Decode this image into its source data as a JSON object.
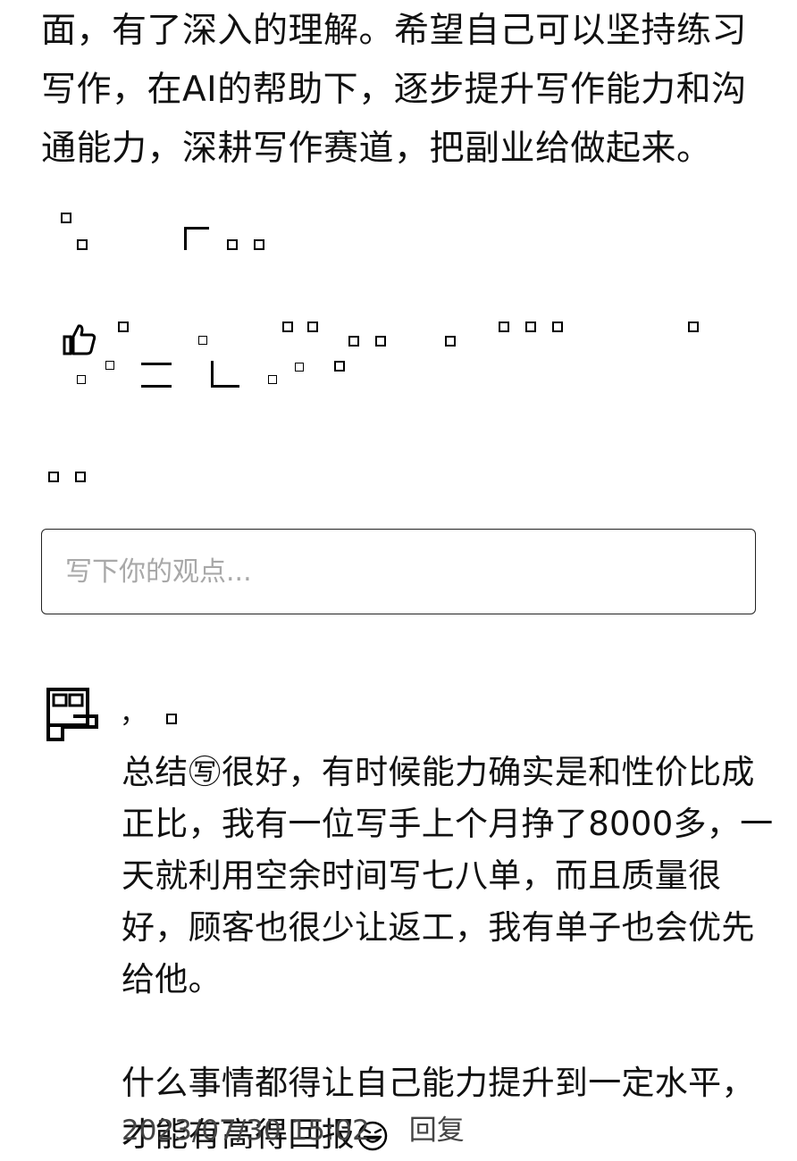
{
  "article": {
    "lines": [
      "面，有了深入的理解。希望自己可以坚持练习",
      "写作，在AI的帮助下，逐步提升写作能力和沟",
      "通能力，深耕写作赛道，把副业给做起来。"
    ]
  },
  "actions": {
    "like_icon": "thumbs-up-icon"
  },
  "comment_box": {
    "placeholder": "写下你的观点..."
  },
  "comment": {
    "name_separator": "，",
    "body_lines": [
      "总结㊢很好，有时候能力确实是和性价比成",
      "正比，我有一位写手上个月挣了8000多，一",
      "天就利用空余时间写七八单，而且质量很",
      "好，顾客也很少让返工，我有单子也会优先",
      "给他。"
    ],
    "body_lines_2": [
      "什么事情都得让自己能力提升到一定水平，",
      "才能有高得回报"
    ],
    "emoji": "grinning-face-icon",
    "timestamp": "2023/07/30 15:02",
    "reply_label": "回复"
  }
}
